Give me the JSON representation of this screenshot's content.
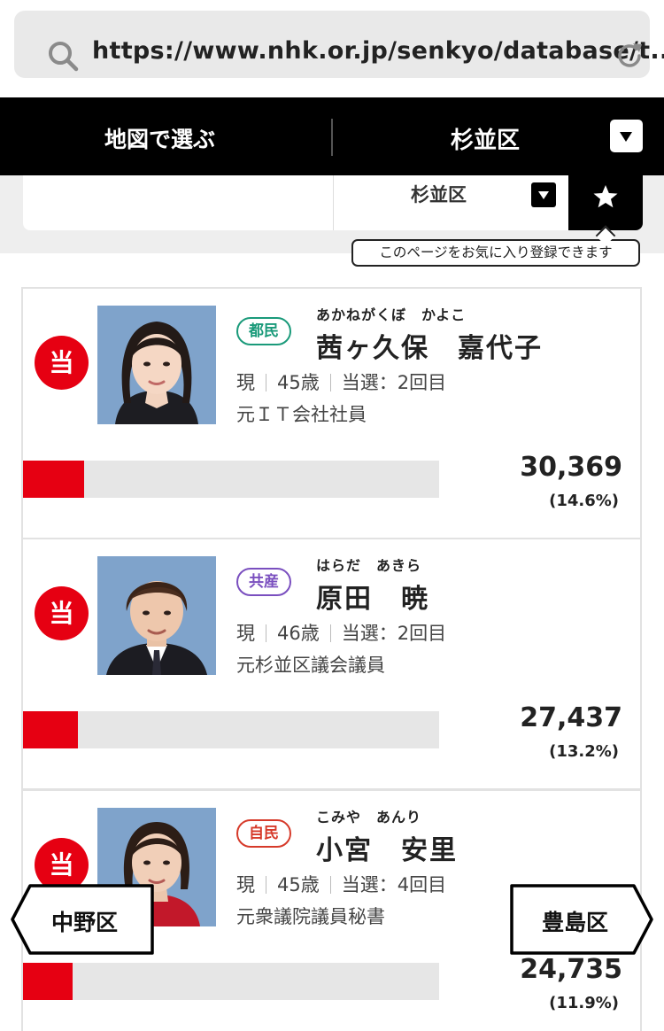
{
  "browser": {
    "url": "https://www.nhk.or.jp/senkyo/database/t..."
  },
  "header": {
    "map_select_label": "地図で選ぶ",
    "district_label": "杉並区"
  },
  "selector": {
    "district_label": "杉並区",
    "tooltip": "このページをお気に入り登録できます"
  },
  "candidates": [
    {
      "badge": "当",
      "party": "都民",
      "party_color": "#1a9a7a",
      "furigana": "あかねがくぼ　かよこ",
      "name": "茜ヶ久保　嘉代子",
      "status": "現",
      "age": "45歳",
      "terms": "当選：2回目",
      "occupation": "元ＩＴ会社社員",
      "votes": "30,369",
      "percent": "(14.6%)",
      "vote_share": 14.6
    },
    {
      "badge": "当",
      "party": "共産",
      "party_color": "#7a4fbf",
      "furigana": "はらだ　あきら",
      "name": "原田　暁",
      "status": "現",
      "age": "46歳",
      "terms": "当選：2回目",
      "occupation": "元杉並区議会議員",
      "votes": "27,437",
      "percent": "(13.2%)",
      "vote_share": 13.2
    },
    {
      "badge": "当",
      "party": "自民",
      "party_color": "#d63a2a",
      "furigana": "こみや　あんり",
      "name": "小宮　安里",
      "status": "現",
      "age": "45歳",
      "terms": "当選：4回目",
      "occupation": "元衆議院議員秘書",
      "votes": "24,735",
      "percent": "(11.9%)",
      "vote_share": 11.9
    }
  ],
  "district_nav": {
    "prev": "中野区",
    "next": "豊島区"
  },
  "colors": {
    "accent_red": "#e60012",
    "header_black": "#000000"
  }
}
